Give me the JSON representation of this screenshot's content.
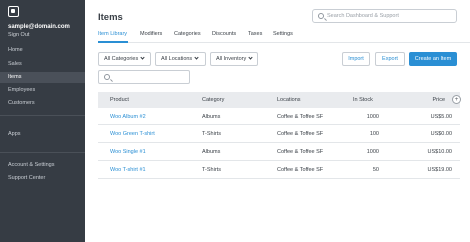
{
  "sidebar": {
    "email": "sample@domain.com",
    "sign_out": "Sign Out",
    "items": [
      {
        "label": "Home"
      },
      {
        "label": "Sales"
      },
      {
        "label": "Items"
      },
      {
        "label": "Employees"
      },
      {
        "label": "Customers"
      },
      {
        "label": "Apps"
      },
      {
        "label": "Account & Settings"
      },
      {
        "label": "Support Center"
      }
    ],
    "active": "Items"
  },
  "header": {
    "title": "Items",
    "search_placeholder": "Search Dashboard & Support"
  },
  "tabs": [
    {
      "label": "Item Library",
      "active": true
    },
    {
      "label": "Modifiers",
      "active": false
    },
    {
      "label": "Categories",
      "active": false
    },
    {
      "label": "Discounts",
      "active": false
    },
    {
      "label": "Taxes",
      "active": false
    },
    {
      "label": "Settings",
      "active": false
    }
  ],
  "filters": {
    "categories": "All Categories",
    "locations": "All Locations",
    "inventory": "All Inventory",
    "search_value": ""
  },
  "actions": {
    "import": "Import",
    "export": "Export",
    "create": "Create an Item"
  },
  "table": {
    "columns": [
      "Product",
      "Category",
      "Locations",
      "In Stock",
      "Price"
    ],
    "rows": [
      {
        "product": "Woo Album #2",
        "category": "Albums",
        "locations": "Coffee & Toffee SF",
        "stock": "1000",
        "price": "US$5.00"
      },
      {
        "product": "Woo Green T-shirt",
        "category": "T-Shirts",
        "locations": "Coffee & Toffee SF",
        "stock": "100",
        "price": "US$0.00"
      },
      {
        "product": "Woo Single #1",
        "category": "Albums",
        "locations": "Coffee & Toffee SF",
        "stock": "1000",
        "price": "US$10.00"
      },
      {
        "product": "Woo T-shirt #1",
        "category": "T-Shirts",
        "locations": "Coffee & Toffee SF",
        "stock": "50",
        "price": "US$19.00"
      }
    ]
  },
  "colors": {
    "sidebar_bg": "#363c44",
    "accent": "#2a8fd4",
    "table_header_bg": "#e9ebee"
  }
}
